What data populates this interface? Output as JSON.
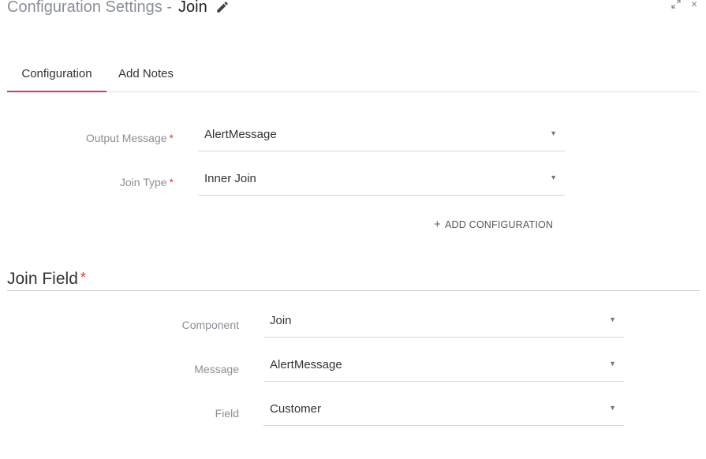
{
  "header": {
    "title_prefix": "Configuration Settings -",
    "component_name": "Join",
    "close_glyph": "×",
    "icons": {
      "edit": "pencil-icon",
      "expand": "expand-icon",
      "close": "close-icon"
    }
  },
  "tabs": [
    {
      "label": "Configuration",
      "active": true
    },
    {
      "label": "Add Notes",
      "active": false
    }
  ],
  "form": {
    "required_mark": "*",
    "output_message": {
      "label": "Output Message",
      "value": "AlertMessage"
    },
    "join_type": {
      "label": "Join Type",
      "value": "Inner Join"
    },
    "add_configuration": {
      "plus": "+",
      "label": "ADD CONFIGURATION"
    }
  },
  "join_field": {
    "title": "Join Field",
    "required_mark": "*",
    "component": {
      "label": "Component",
      "value": "Join"
    },
    "message": {
      "label": "Message",
      "value": "AlertMessage"
    },
    "field": {
      "label": "Field",
      "value": "Customer"
    }
  },
  "colors": {
    "accent": "#d6336c",
    "required": "#e53935",
    "label": "#8a8f96"
  }
}
